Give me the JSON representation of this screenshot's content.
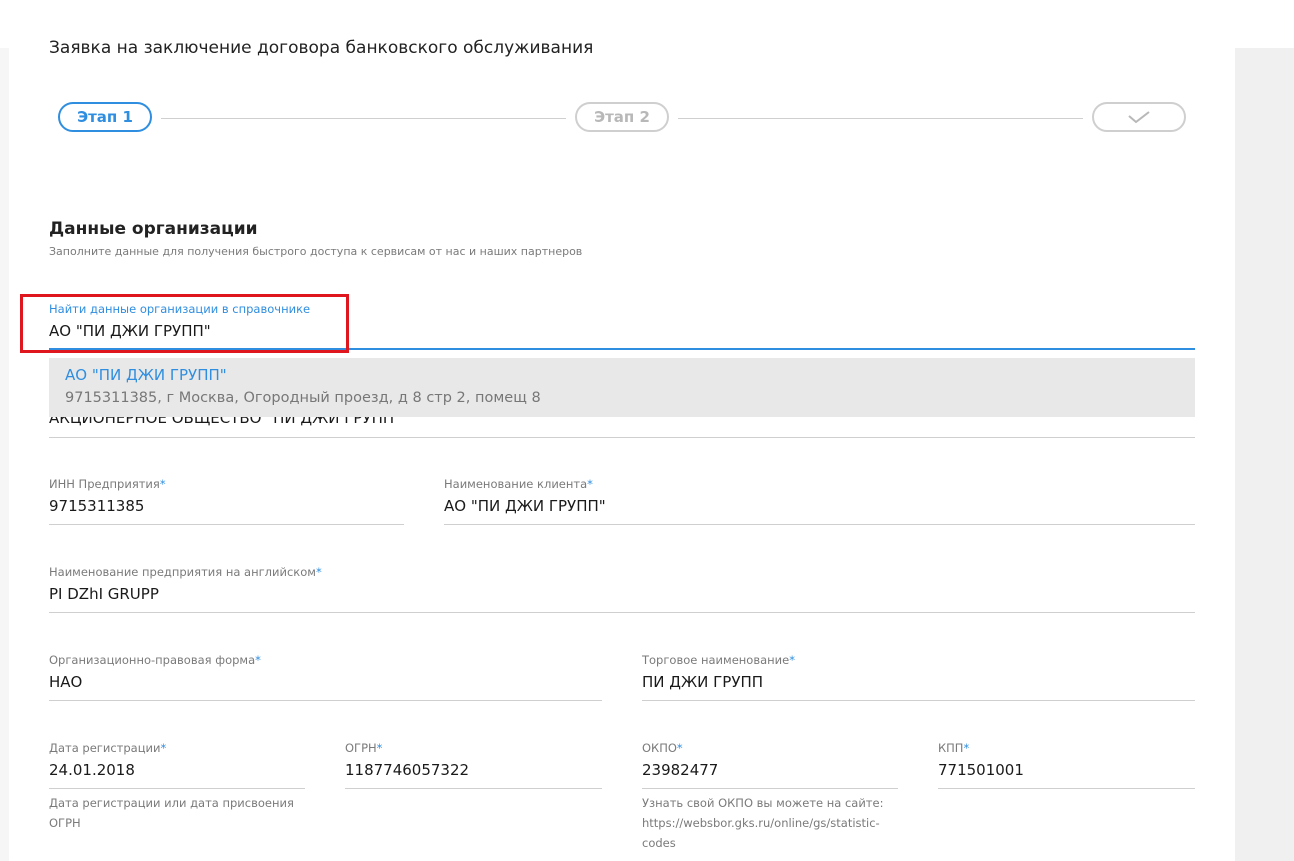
{
  "page_title": "Заявка на заключение договора банковского обслуживания",
  "stepper": {
    "step1": "Этап 1",
    "step2": "Этап 2",
    "step3_icon": "checkmark-icon"
  },
  "section": {
    "title": "Данные организации",
    "subtitle": "Заполните данные для получения быстрого доступа к сервисам от нас и наших партнеров"
  },
  "search": {
    "label": "Найти данные организации в справочнике",
    "value": "АО \"ПИ ДЖИ ГРУПП\""
  },
  "suggestion": {
    "name": "АО \"ПИ ДЖИ ГРУПП\"",
    "details": "9715311385, г Москва, Огородный проезд, д 8 стр 2, помещ 8"
  },
  "full_name_value": "АКЦИОНЕРНОЕ ОБЩЕСТВО \"ПИ ДЖИ ГРУПП\"",
  "fields": {
    "inn": {
      "label": "ИНН Предприятия",
      "value": "9715311385"
    },
    "client_name": {
      "label": "Наименование клиента",
      "value": "АО \"ПИ ДЖИ ГРУПП\""
    },
    "english_name": {
      "label": "Наименование предприятия на английском",
      "value": "PI DZhI GRUPP"
    },
    "legal_form": {
      "label": "Организационно-правовая форма",
      "value": "НАО"
    },
    "trade_name": {
      "label": "Торговое наименование",
      "value": "ПИ ДЖИ ГРУПП"
    },
    "reg_date": {
      "label": "Дата регистрации",
      "value": "24.01.2018"
    },
    "ogrn": {
      "label": "ОГРН",
      "value": "1187746057322"
    },
    "okpo": {
      "label": "ОКПО",
      "value": "23982477"
    },
    "kpp": {
      "label": "КПП",
      "value": "771501001"
    }
  },
  "required_mark": "*",
  "hints": {
    "reg_date_line1": "Дата регистрации или дата присвоения",
    "reg_date_line2": "ОГРН",
    "okpo_line1": "Узнать свой ОКПО вы можете на сайте:",
    "okpo_line2": "https://websbor.gks.ru/online/gs/statistic-",
    "okpo_line3": "codes"
  },
  "colors": {
    "accent": "#2f8ee0",
    "highlight": "#e0161e"
  }
}
